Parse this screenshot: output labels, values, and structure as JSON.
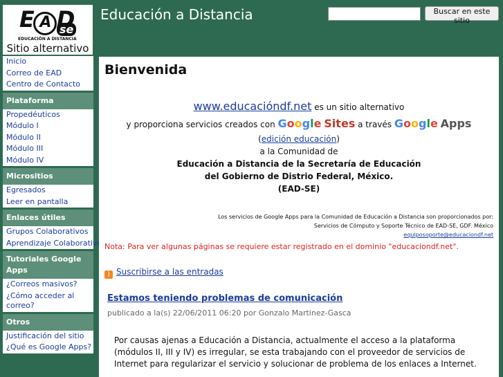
{
  "header": {
    "logo_text": "EAD",
    "logo_se": "se",
    "logo_tagline": "EDUCACIÓN A DISTANCIA",
    "alt_site_label": "Sitio alternativo",
    "site_title": "Educación a Distancia",
    "search_placeholder": "",
    "search_button": "Buscar en este sitio"
  },
  "sidebar": {
    "groups": [
      {
        "title": "",
        "items": [
          "Inicio",
          "Correo de EAD",
          "Centro de Contacto"
        ]
      },
      {
        "title": "Plataforma",
        "items": [
          "Propedéuticos",
          "Módulo I",
          "Módulo II",
          "Módulo III",
          "Módulo IV"
        ]
      },
      {
        "title": "Micrositios",
        "items": [
          "Egresados",
          "Leer en pantalla"
        ]
      },
      {
        "title": "Enlaces útiles",
        "items": [
          "Grupos Colaborativos",
          "Aprendizaje Colaborativo"
        ]
      },
      {
        "title": "Tutoriales Google Apps",
        "items": [
          "¿Correos masivos?",
          "¿Cómo acceder al correo?"
        ]
      },
      {
        "title": "Otros",
        "items": [
          "Justificación del sitio",
          "¿Qué es Google Apps?"
        ]
      }
    ]
  },
  "main": {
    "title": "Bienvenida",
    "url_link": "www.educacióndf.net",
    "intro_tail": "es un sitio alternativo",
    "line2_pre": "y proporciona servicios creados con",
    "google": "Google",
    "sites": "Sites",
    "line2_mid": "a través",
    "apps": "Apps",
    "edicion_link": "edición educación",
    "line4": "a la Comunidad de",
    "bold1": "Educación a Distancia de la Secretaría de Educación",
    "bold2": "del Gobierno de Distrio Federal, México.",
    "bold3": "(EAD-SE)",
    "small1": "Los servicios de Google Apps para la Comunidad de Educación a Distancia son proporcionados por:",
    "small2": "Servicios de Cómputo y Soporte Técnico de EAD-SE, GDF. México",
    "small3": "equiposoporte@educaciondf.net",
    "note": "Nota: Para ver algunas páginas se requiere estar registrado en el dominio \"educaciondf.net\".",
    "subscribe": "Suscribirse a las entradas",
    "post_title": "Estamos teniendo problemas de comunicación",
    "post_meta": "publicado a la(s) 22/06/2011 06:20 por Gonzalo Martinez-Gasca",
    "post_body": "Por causas ajenas a Educación a Distancia, actualmente el acceso a la plataforma (módulos II, III y IV) es irregular, se esta trabajando con el proveedor de servicios de Internet para regularizar el servicio y solucionar de problema de los enlaces a Internet."
  }
}
